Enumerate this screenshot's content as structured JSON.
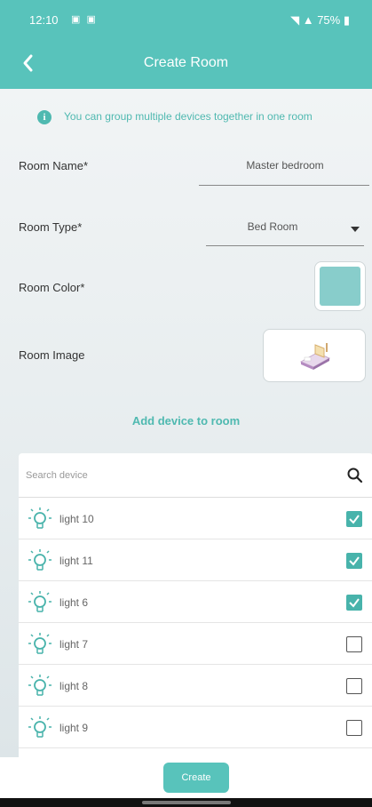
{
  "status_bar": {
    "time": "12:10",
    "left_icons": "▣ ▣",
    "right_text": "75%"
  },
  "app_bar": {
    "title": "Create Room",
    "back_icon": "back-arrow-icon"
  },
  "info": {
    "text": "You can group multiple devices together in one room",
    "icon": "i"
  },
  "form": {
    "room_name": {
      "label": "Room Name*",
      "value": "Master bedroom"
    },
    "room_type": {
      "label": "Room Type*",
      "value": "Bed Room"
    },
    "room_color": {
      "label": "Room Color*",
      "color": "#88cdcb"
    },
    "room_image": {
      "label": "Room Image"
    }
  },
  "add_device_label": "Add device to room",
  "search": {
    "placeholder": "Search device"
  },
  "devices": [
    {
      "label": "light 10",
      "checked": true
    },
    {
      "label": "light 11",
      "checked": true
    },
    {
      "label": "light 6",
      "checked": true
    },
    {
      "label": "light 7",
      "checked": false
    },
    {
      "label": "light 8",
      "checked": false
    },
    {
      "label": "light 9",
      "checked": false
    }
  ],
  "create_label": "Create",
  "colors": {
    "accent": "#58c3bb",
    "checkbox_checked": "#48b3ab",
    "link": "#4fb9b0"
  }
}
